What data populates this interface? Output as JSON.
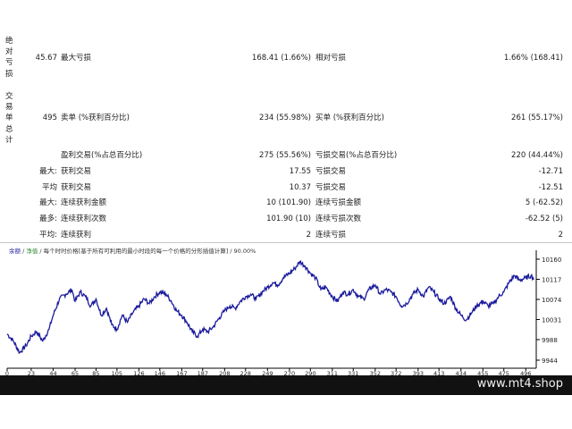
{
  "stats": {
    "drawdown_abs_label": "绝对亏损",
    "drawdown_abs_value": "45.67",
    "max_drawdown_label": "最大亏损",
    "max_drawdown_value": "168.41 (1.66%)",
    "rel_drawdown_label": "相对亏损",
    "rel_drawdown_value": "1.66% (168.41)",
    "total_trades_label": "交易单总计",
    "total_trades_value": "495",
    "short_label": "卖单 (%获利百分比)",
    "short_value": "234 (55.98%)",
    "long_label": "买单 (%获利百分比)",
    "long_value": "261 (55.17%)",
    "profit_trades_label": "盈利交易(%占总百分比)",
    "profit_trades_value": "275 (55.56%)",
    "loss_trades_label": "亏损交易(%占总百分比)",
    "loss_trades_value": "220 (44.44%)"
  },
  "stat_rows": [
    {
      "prefix": "最大:",
      "l_label": "获利交易",
      "l_value": "17.55",
      "r_label": "亏损交易",
      "r_value": "-12.71"
    },
    {
      "prefix": "平均",
      "l_label": "获利交易",
      "l_value": "10.37",
      "r_label": "亏损交易",
      "r_value": "-12.51"
    },
    {
      "prefix": "最大:",
      "l_label": "连续获利金额",
      "l_value": "10 (101.90)",
      "r_label": "连续亏损金额",
      "r_value": "5 (-62.52)"
    },
    {
      "prefix": "最多:",
      "l_label": "连续获利次数",
      "l_value": "101.90 (10)",
      "r_label": "连续亏损次数",
      "r_value": "-62.52 (5)"
    },
    {
      "prefix": "平均:",
      "l_label": "连续获利",
      "l_value": "2",
      "r_label": "连续亏损",
      "r_value": "2"
    }
  ],
  "chart_header": {
    "balance": "余额",
    "sep1": " / ",
    "equity": "净值",
    "sep2": " / ",
    "desc": "每个时时价格[基于所有可利用的最小时段的每一个价格的分形插值计算] / 90.00%"
  },
  "chart_data": {
    "type": "line",
    "yticks": [
      "10160",
      "10117",
      "10074",
      "10031",
      "9988",
      "9944"
    ],
    "xticks": [
      "0",
      "23",
      "44",
      "65",
      "85",
      "105",
      "126",
      "146",
      "167",
      "187",
      "208",
      "228",
      "249",
      "270",
      "290",
      "311",
      "331",
      "352",
      "372",
      "393",
      "413",
      "434",
      "455",
      "475",
      "496"
    ],
    "ylim": [
      9944,
      10160
    ],
    "xlim": [
      0,
      506
    ],
    "series": [
      {
        "color": "#1a1a9c",
        "x": [
          0,
          6,
          12,
          18,
          23,
          28,
          34,
          40,
          44,
          50,
          56,
          62,
          65,
          70,
          75,
          80,
          85,
          90,
          95,
          100,
          105,
          110,
          115,
          120,
          126,
          131,
          136,
          141,
          146,
          152,
          157,
          162,
          167,
          172,
          177,
          182,
          187,
          192,
          197,
          203,
          208,
          213,
          218,
          223,
          228,
          233,
          238,
          244,
          249,
          254,
          259,
          264,
          270,
          275,
          280,
          285,
          290,
          295,
          300,
          305,
          311,
          316,
          321,
          326,
          331,
          336,
          341,
          346,
          352,
          357,
          362,
          367,
          372,
          377,
          382,
          388,
          393,
          398,
          403,
          408,
          413,
          418,
          424,
          429,
          434,
          439,
          444,
          449,
          455,
          460,
          465,
          470,
          475,
          480,
          485,
          490,
          496,
          501,
          504
        ],
        "y": [
          10000,
          9985,
          9960,
          9975,
          9995,
          10005,
          9985,
          10010,
          10040,
          10075,
          10085,
          10095,
          10070,
          10090,
          10080,
          10060,
          10075,
          10040,
          10055,
          10020,
          10010,
          10040,
          10025,
          10045,
          10060,
          10075,
          10065,
          10080,
          10090,
          10085,
          10070,
          10050,
          10040,
          10025,
          10005,
          9995,
          10010,
          10005,
          10015,
          10035,
          10050,
          10060,
          10055,
          10070,
          10080,
          10085,
          10075,
          10090,
          10100,
          10110,
          10105,
          10120,
          10130,
          10140,
          10155,
          10145,
          10130,
          10120,
          10095,
          10100,
          10080,
          10070,
          10090,
          10085,
          10095,
          10080,
          10075,
          10095,
          10105,
          10085,
          10095,
          10090,
          10080,
          10060,
          10065,
          10085,
          10095,
          10080,
          10100,
          10090,
          10075,
          10065,
          10080,
          10055,
          10040,
          10030,
          10045,
          10060,
          10070,
          10060,
          10065,
          10080,
          10090,
          10110,
          10125,
          10115,
          10120,
          10125,
          10118
        ]
      }
    ]
  },
  "watermark": "www.mt4.shop"
}
